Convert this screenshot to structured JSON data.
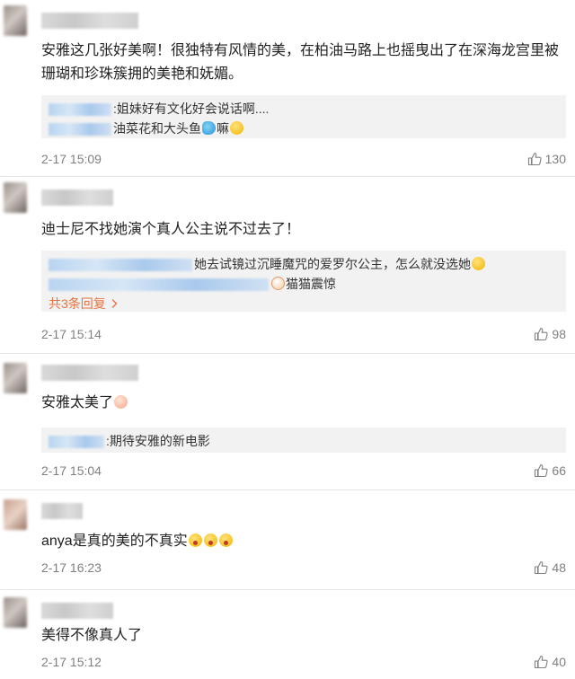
{
  "comments": [
    {
      "content": "安雅这几张好美啊！很独特有风情的美，在柏油马路上也摇曳出了在深海龙宫里被珊瑚和珍珠簇拥的美艳和妩媚。",
      "replies": [
        {
          "text": ":姐妹好有文化好会说话啊...."
        },
        {
          "text": "油菜花和大头鱼",
          "suffix": "嘛",
          "emoji_mid": "fish-emoji",
          "emoji_end": "smile-emoji"
        }
      ],
      "timestamp": "2-17 15:09",
      "likes": "130"
    },
    {
      "content": "迪士尼不找她演个真人公主说不过去了！",
      "replies": [
        {
          "text": "她去试镜过沉睡魔咒的爱罗尔公主，怎么就没选她",
          "emoji_end": "smile-emoji"
        },
        {
          "text": "猫猫震惊",
          "emoji_start": "cat-emoji"
        }
      ],
      "more_replies": "共3条回复",
      "timestamp": "2-17 15:14",
      "likes": "98"
    },
    {
      "content": "安雅太美了",
      "content_emoji": "cute-emoji",
      "replies": [
        {
          "text": ":期待安雅的新电影"
        }
      ],
      "timestamp": "2-17 15:04",
      "likes": "66"
    },
    {
      "content": "anya是真的美的不真实",
      "content_emoji": "shock-emoji",
      "timestamp": "2-17 16:23",
      "likes": "48"
    },
    {
      "content": "美得不像真人了",
      "timestamp": "2-17 15:12",
      "likes": "40"
    }
  ],
  "icons": {
    "like": "thumb-up-icon",
    "more_arrow": "chevron-right-icon"
  },
  "colors": {
    "more_link": "#eb7340",
    "meta": "#808080",
    "reply_bg": "#f2f2f2",
    "blur_name": "#b8d4f0"
  }
}
